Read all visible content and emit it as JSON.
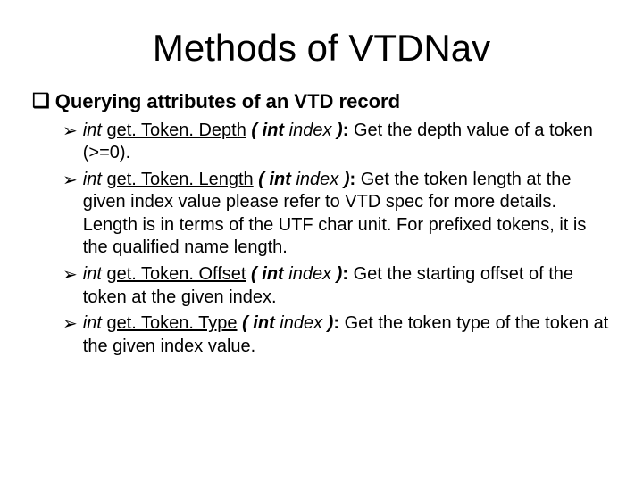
{
  "title": "Methods of VTDNav",
  "section_bullet": "❑",
  "section_heading": "Querying attributes of an VTD record",
  "item_bullet": "➢",
  "sig": {
    "ret": "int",
    "open": " (",
    "argtype": "int",
    "argname": " index",
    "close": "):"
  },
  "methods": [
    {
      "name": "get. Token. Depth",
      "desc": " Get the depth value of a token (>=0)."
    },
    {
      "name": "get. Token. Length",
      "desc": " Get the token length at the given index value please refer to VTD spec for more details. Length is in terms of the UTF char unit. For prefixed tokens, it is the qualified name length."
    },
    {
      "name": "get. Token. Offset",
      "desc": " Get the starting offset of the token at the given index."
    },
    {
      "name": "get. Token. Type",
      "desc": " Get the token type of the token at the given index value."
    }
  ]
}
